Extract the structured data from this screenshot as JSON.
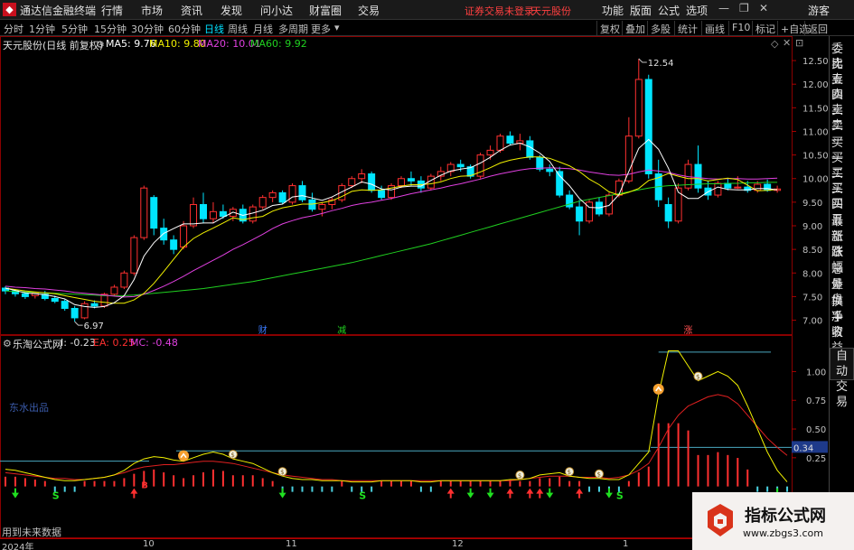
{
  "menubar": {
    "app_title": "通达信金融终端",
    "items": [
      "行情",
      "市场",
      "资讯",
      "发现",
      "问小达",
      "财富圈",
      "交易"
    ],
    "warning": "证券交易未登录",
    "stock_name": "天元股份",
    "right_items": [
      "功能",
      "版面",
      "公式",
      "选项"
    ],
    "guest_label": "游客"
  },
  "toolbar": {
    "periods": [
      "分时",
      "1分钟",
      "5分钟",
      "15分钟",
      "30分钟",
      "60分钟",
      "日线",
      "周线",
      "月线",
      "多周期",
      "更多"
    ],
    "active_period": "日线",
    "right_buttons": [
      "复权",
      "叠加",
      "多股",
      "统计",
      "画线",
      "F10",
      "标记",
      "+自选",
      "返回"
    ]
  },
  "sidebar": {
    "items": [
      "委比",
      "卖五",
      "卖四",
      "卖三",
      "卖二",
      "卖一",
      "买一",
      "买二",
      "买三",
      "买四",
      "买五",
      "最新",
      "涨跌",
      "涨幅",
      "总量",
      "外盘",
      "换手",
      "净资",
      "收益"
    ],
    "auto_trade": [
      "自动",
      "交易"
    ]
  },
  "main": {
    "title": "天元股份(日线 前复权)",
    "ma5": "MA5: 9.76",
    "ma10": "MA10: 9.80",
    "ma20": "MA20: 10.01",
    "ma60": "MA60: 9.92",
    "high_label": "12.54",
    "low_label": "6.97",
    "event_labels": [
      "财",
      "减",
      "涨"
    ],
    "y_ticks": [
      "12.50",
      "12.00",
      "11.50",
      "11.00",
      "10.50",
      "10.00",
      "9.50",
      "9.00",
      "8.50",
      "8.00",
      "7.50",
      "7.00"
    ],
    "colors": {
      "up": "#ff3030",
      "down": "#00e5ff",
      "ma5": "#ffffff",
      "ma10": "#f0f000",
      "ma20": "#e040e0",
      "ma60": "#20d020"
    }
  },
  "indicator": {
    "title": "乐淘公式网",
    "i_value": "I: -0.23",
    "ea_value": "EA: 0.25",
    "mc_value": "MC: -0.48",
    "caption": "东水出品",
    "y_ticks": [
      "1.00",
      "0.75",
      "0.50",
      "0.25"
    ],
    "current_value": "0.34",
    "footer_note": "用到未来数据"
  },
  "xaxis": {
    "labels": [
      "2024年",
      "10",
      "11",
      "12",
      "1"
    ]
  },
  "watermark": {
    "title": "指标公式网",
    "url": "www.zbgs3.com"
  },
  "chart_data": [
    {
      "type": "candlestick",
      "title": "天元股份(日线 前复权)",
      "ylim": [
        6.8,
        12.75
      ],
      "candles": [
        {
          "o": 7.68,
          "h": 7.72,
          "l": 7.55,
          "c": 7.62
        },
        {
          "o": 7.62,
          "h": 7.66,
          "l": 7.5,
          "c": 7.56
        },
        {
          "o": 7.56,
          "h": 7.6,
          "l": 7.45,
          "c": 7.5
        },
        {
          "o": 7.52,
          "h": 7.6,
          "l": 7.46,
          "c": 7.58
        },
        {
          "o": 7.55,
          "h": 7.62,
          "l": 7.42,
          "c": 7.46
        },
        {
          "o": 7.46,
          "h": 7.52,
          "l": 7.36,
          "c": 7.4
        },
        {
          "o": 7.4,
          "h": 7.44,
          "l": 7.2,
          "c": 7.25
        },
        {
          "o": 7.25,
          "h": 7.3,
          "l": 6.97,
          "c": 7.05
        },
        {
          "o": 7.05,
          "h": 7.4,
          "l": 7.02,
          "c": 7.35
        },
        {
          "o": 7.35,
          "h": 7.42,
          "l": 7.25,
          "c": 7.3
        },
        {
          "o": 7.3,
          "h": 7.58,
          "l": 7.26,
          "c": 7.55
        },
        {
          "o": 7.55,
          "h": 7.75,
          "l": 7.5,
          "c": 7.7
        },
        {
          "o": 7.7,
          "h": 8.05,
          "l": 7.66,
          "c": 8.0
        },
        {
          "o": 8.0,
          "h": 8.8,
          "l": 7.95,
          "c": 8.75
        },
        {
          "o": 8.75,
          "h": 9.85,
          "l": 8.7,
          "c": 9.8
        },
        {
          "o": 9.6,
          "h": 9.65,
          "l": 8.8,
          "c": 8.95
        },
        {
          "o": 8.95,
          "h": 9.15,
          "l": 8.6,
          "c": 8.7
        },
        {
          "o": 8.7,
          "h": 8.8,
          "l": 8.4,
          "c": 8.5
        },
        {
          "o": 8.55,
          "h": 9.1,
          "l": 8.5,
          "c": 9.0
        },
        {
          "o": 9.0,
          "h": 9.6,
          "l": 8.95,
          "c": 9.45
        },
        {
          "o": 9.45,
          "h": 9.7,
          "l": 9.05,
          "c": 9.15
        },
        {
          "o": 9.15,
          "h": 9.5,
          "l": 9.05,
          "c": 9.3
        },
        {
          "o": 9.3,
          "h": 9.45,
          "l": 9.15,
          "c": 9.2
        },
        {
          "o": 9.2,
          "h": 9.4,
          "l": 9.1,
          "c": 9.35
        },
        {
          "o": 9.35,
          "h": 9.45,
          "l": 9.05,
          "c": 9.1
        },
        {
          "o": 9.1,
          "h": 9.45,
          "l": 9.05,
          "c": 9.4
        },
        {
          "o": 9.4,
          "h": 9.65,
          "l": 9.35,
          "c": 9.6
        },
        {
          "o": 9.6,
          "h": 9.75,
          "l": 9.5,
          "c": 9.7
        },
        {
          "o": 9.7,
          "h": 9.75,
          "l": 9.45,
          "c": 9.5
        },
        {
          "o": 9.5,
          "h": 9.9,
          "l": 9.45,
          "c": 9.85
        },
        {
          "o": 9.85,
          "h": 9.95,
          "l": 9.5,
          "c": 9.55
        },
        {
          "o": 9.55,
          "h": 9.7,
          "l": 9.3,
          "c": 9.35
        },
        {
          "o": 9.35,
          "h": 9.5,
          "l": 9.2,
          "c": 9.45
        },
        {
          "o": 9.45,
          "h": 9.6,
          "l": 9.35,
          "c": 9.55
        },
        {
          "o": 9.55,
          "h": 9.9,
          "l": 9.5,
          "c": 9.85
        },
        {
          "o": 9.85,
          "h": 10.05,
          "l": 9.8,
          "c": 10.0
        },
        {
          "o": 10.0,
          "h": 10.2,
          "l": 9.9,
          "c": 10.1
        },
        {
          "o": 10.1,
          "h": 10.15,
          "l": 9.7,
          "c": 9.75
        },
        {
          "o": 9.75,
          "h": 9.85,
          "l": 9.55,
          "c": 9.6
        },
        {
          "o": 9.6,
          "h": 9.9,
          "l": 9.55,
          "c": 9.85
        },
        {
          "o": 9.85,
          "h": 10.05,
          "l": 9.8,
          "c": 10.0
        },
        {
          "o": 10.0,
          "h": 10.15,
          "l": 9.85,
          "c": 9.95
        },
        {
          "o": 9.95,
          "h": 10.05,
          "l": 9.7,
          "c": 9.8
        },
        {
          "o": 9.8,
          "h": 10.1,
          "l": 9.75,
          "c": 10.05
        },
        {
          "o": 10.05,
          "h": 10.25,
          "l": 9.95,
          "c": 10.15
        },
        {
          "o": 10.15,
          "h": 10.35,
          "l": 10.05,
          "c": 10.3
        },
        {
          "o": 10.3,
          "h": 10.4,
          "l": 10.15,
          "c": 10.25
        },
        {
          "o": 10.25,
          "h": 10.3,
          "l": 10.0,
          "c": 10.05
        },
        {
          "o": 10.05,
          "h": 10.55,
          "l": 10.0,
          "c": 10.5
        },
        {
          "o": 10.5,
          "h": 10.7,
          "l": 10.4,
          "c": 10.6
        },
        {
          "o": 10.6,
          "h": 10.95,
          "l": 10.55,
          "c": 10.9
        },
        {
          "o": 10.9,
          "h": 11.0,
          "l": 10.7,
          "c": 10.75
        },
        {
          "o": 10.75,
          "h": 10.95,
          "l": 10.6,
          "c": 10.8
        },
        {
          "o": 10.8,
          "h": 10.9,
          "l": 10.4,
          "c": 10.45
        },
        {
          "o": 10.45,
          "h": 10.5,
          "l": 10.15,
          "c": 10.2
        },
        {
          "o": 10.2,
          "h": 10.3,
          "l": 10.05,
          "c": 10.15
        },
        {
          "o": 10.15,
          "h": 10.25,
          "l": 9.6,
          "c": 9.65
        },
        {
          "o": 9.65,
          "h": 9.75,
          "l": 9.35,
          "c": 9.4
        },
        {
          "o": 9.4,
          "h": 9.55,
          "l": 8.8,
          "c": 9.1
        },
        {
          "o": 9.1,
          "h": 9.55,
          "l": 9.05,
          "c": 9.5
        },
        {
          "o": 9.5,
          "h": 9.6,
          "l": 9.2,
          "c": 9.25
        },
        {
          "o": 9.25,
          "h": 9.7,
          "l": 9.2,
          "c": 9.65
        },
        {
          "o": 9.65,
          "h": 10.0,
          "l": 9.6,
          "c": 9.95
        },
        {
          "o": 9.95,
          "h": 11.3,
          "l": 9.9,
          "c": 10.9
        },
        {
          "o": 10.9,
          "h": 12.54,
          "l": 10.85,
          "c": 12.1
        },
        {
          "o": 12.1,
          "h": 12.2,
          "l": 10.0,
          "c": 10.1
        },
        {
          "o": 10.1,
          "h": 10.4,
          "l": 9.4,
          "c": 9.55
        },
        {
          "o": 9.45,
          "h": 9.6,
          "l": 8.95,
          "c": 9.1
        },
        {
          "o": 9.1,
          "h": 9.9,
          "l": 9.05,
          "c": 9.8
        },
        {
          "o": 9.8,
          "h": 10.4,
          "l": 9.75,
          "c": 10.3
        },
        {
          "o": 10.3,
          "h": 10.7,
          "l": 9.7,
          "c": 9.8
        },
        {
          "o": 9.8,
          "h": 9.95,
          "l": 9.55,
          "c": 9.65
        },
        {
          "o": 9.65,
          "h": 9.95,
          "l": 9.6,
          "c": 9.9
        },
        {
          "o": 9.9,
          "h": 10.0,
          "l": 9.75,
          "c": 9.8
        },
        {
          "o": 9.8,
          "h": 10.05,
          "l": 9.78,
          "c": 9.82
        },
        {
          "o": 9.82,
          "h": 9.95,
          "l": 9.7,
          "c": 9.75
        },
        {
          "o": 9.75,
          "h": 9.95,
          "l": 9.7,
          "c": 9.88
        },
        {
          "o": 9.88,
          "h": 9.98,
          "l": 9.72,
          "c": 9.75
        },
        {
          "o": 9.75,
          "h": 9.85,
          "l": 9.7,
          "c": 9.78
        }
      ],
      "ma5": [
        7.68,
        7.63,
        7.58,
        7.56,
        7.54,
        7.5,
        7.45,
        7.33,
        7.29,
        7.27,
        7.29,
        7.37,
        7.52,
        7.86,
        8.36,
        8.64,
        8.84,
        8.94,
        9.04,
        9.04,
        9.06,
        9.06,
        9.18,
        9.29,
        9.22,
        9.27,
        9.33,
        9.43,
        9.46,
        9.61,
        9.64,
        9.59,
        9.54,
        9.61,
        9.72,
        9.82,
        9.93,
        9.88,
        9.78,
        9.76,
        9.82,
        9.84,
        9.84,
        9.96,
        10.07,
        10.16,
        10.2,
        10.23,
        10.33,
        10.45,
        10.6,
        10.71,
        10.75,
        10.67,
        10.54,
        10.36,
        10.06,
        9.85,
        9.58,
        9.39,
        9.38,
        9.43,
        9.66,
        10.15,
        10.64,
        10.83,
        10.62,
        10.22,
        9.71,
        9.58,
        9.58,
        9.72,
        9.82,
        9.77,
        9.76,
        9.76,
        9.79,
        9.79,
        9.76
      ],
      "ma10": [
        7.68,
        7.65,
        7.62,
        7.6,
        7.58,
        7.56,
        7.52,
        7.48,
        7.44,
        7.4,
        7.38,
        7.36,
        7.36,
        7.43,
        7.57,
        7.78,
        8.03,
        8.29,
        8.55,
        8.73,
        8.85,
        8.95,
        9.06,
        9.17,
        9.13,
        9.17,
        9.2,
        9.31,
        9.38,
        9.42,
        9.46,
        9.46,
        9.49,
        9.53,
        9.62,
        9.73,
        9.76,
        9.75,
        9.76,
        9.8,
        9.84,
        9.87,
        9.87,
        9.89,
        9.93,
        10.0,
        10.05,
        10.06,
        10.14,
        10.23,
        10.33,
        10.39,
        10.43,
        10.46,
        10.46,
        10.43,
        10.35,
        10.27,
        10.15,
        9.99,
        9.87,
        9.72,
        9.65,
        9.71,
        9.79,
        9.96,
        10.02,
        10.11,
        10.05,
        10.0,
        10.0,
        9.95,
        9.98,
        10.01,
        9.98,
        9.86,
        9.74,
        9.75,
        9.77
      ],
      "ma20": [
        7.72,
        7.7,
        7.69,
        7.67,
        7.66,
        7.64,
        7.62,
        7.59,
        7.57,
        7.55,
        7.53,
        7.51,
        7.49,
        7.5,
        7.55,
        7.63,
        7.72,
        7.82,
        7.93,
        8.05,
        8.16,
        8.27,
        8.38,
        8.5,
        8.6,
        8.71,
        8.82,
        8.94,
        9.04,
        9.11,
        9.17,
        9.21,
        9.26,
        9.32,
        9.37,
        9.43,
        9.47,
        9.5,
        9.54,
        9.58,
        9.63,
        9.68,
        9.72,
        9.76,
        9.8,
        9.85,
        9.89,
        9.94,
        9.99,
        10.05,
        10.1,
        10.14,
        10.18,
        10.21,
        10.22,
        10.23,
        10.22,
        10.21,
        10.18,
        10.14,
        10.11,
        10.08,
        10.07,
        10.09,
        10.14,
        10.18,
        10.16,
        10.13,
        10.08,
        10.04,
        10.02,
        10.0,
        9.99,
        10.0,
        10.0,
        9.99,
        9.99,
        10.0,
        10.01
      ],
      "ma60": [
        7.62,
        7.61,
        7.6,
        7.59,
        7.58,
        7.57,
        7.56,
        7.55,
        7.54,
        7.53,
        7.52,
        7.52,
        7.52,
        7.53,
        7.55,
        7.57,
        7.59,
        7.61,
        7.63,
        7.65,
        7.67,
        7.7,
        7.73,
        7.76,
        7.79,
        7.82,
        7.86,
        7.9,
        7.94,
        7.98,
        8.02,
        8.06,
        8.1,
        8.14,
        8.18,
        8.22,
        8.27,
        8.32,
        8.37,
        8.42,
        8.47,
        8.52,
        8.57,
        8.62,
        8.68,
        8.74,
        8.8,
        8.86,
        8.92,
        8.98,
        9.04,
        9.1,
        9.16,
        9.22,
        9.28,
        9.34,
        9.4,
        9.46,
        9.52,
        9.56,
        9.6,
        9.64,
        9.68,
        9.72,
        9.76,
        9.8,
        9.83,
        9.85,
        9.86,
        9.87,
        9.88,
        9.89,
        9.89,
        9.9,
        9.9,
        9.91,
        9.91,
        9.92,
        9.92
      ]
    },
    {
      "type": "line",
      "title": "乐淘公式网",
      "ylim": [
        -0.05,
        1.2
      ],
      "series": [
        {
          "name": "I",
          "values": [
            0.15,
            0.14,
            0.12,
            0.1,
            0.08,
            0.06,
            0.05,
            0.05,
            0.06,
            0.07,
            0.08,
            0.1,
            0.14,
            0.2,
            0.24,
            0.26,
            0.25,
            0.23,
            0.22,
            0.25,
            0.28,
            0.3,
            0.28,
            0.24,
            0.22,
            0.2,
            0.16,
            0.12,
            0.09,
            0.07,
            0.06,
            0.06,
            0.05,
            0.05,
            0.05,
            0.04,
            0.04,
            0.04,
            0.05,
            0.05,
            0.05,
            0.05,
            0.04,
            0.04,
            0.05,
            0.05,
            0.05,
            0.05,
            0.05,
            0.05,
            0.05,
            0.06,
            0.06,
            0.07,
            0.1,
            0.11,
            0.12,
            0.09,
            0.08,
            0.07,
            0.07,
            0.06,
            0.06,
            0.1,
            0.2,
            0.3,
            0.8,
            1.18,
            1.18,
            1.05,
            0.92,
            0.96,
            1.0,
            0.96,
            0.88,
            0.7,
            0.5,
            0.3,
            0.14,
            0.04
          ]
        },
        {
          "name": "EA",
          "values": [
            0.12,
            0.11,
            0.1,
            0.09,
            0.08,
            0.07,
            0.07,
            0.06,
            0.06,
            0.07,
            0.08,
            0.1,
            0.12,
            0.15,
            0.17,
            0.18,
            0.19,
            0.19,
            0.2,
            0.21,
            0.22,
            0.22,
            0.21,
            0.2,
            0.18,
            0.16,
            0.14,
            0.12,
            0.1,
            0.09,
            0.08,
            0.07,
            0.06,
            0.06,
            0.05,
            0.05,
            0.05,
            0.05,
            0.05,
            0.05,
            0.05,
            0.05,
            0.05,
            0.05,
            0.05,
            0.05,
            0.05,
            0.05,
            0.05,
            0.05,
            0.05,
            0.05,
            0.06,
            0.07,
            0.08,
            0.09,
            0.09,
            0.09,
            0.08,
            0.08,
            0.08,
            0.07,
            0.08,
            0.1,
            0.14,
            0.2,
            0.34,
            0.5,
            0.62,
            0.7,
            0.74,
            0.78,
            0.8,
            0.78,
            0.72,
            0.62,
            0.52,
            0.42,
            0.34,
            0.27
          ]
        }
      ],
      "reference_lines": [
        0.34,
        1.17
      ],
      "signals": [
        {
          "kind": "up",
          "i": 13
        },
        {
          "kind": "up",
          "i": 45
        },
        {
          "kind": "up",
          "i": 51
        },
        {
          "kind": "up",
          "i": 53
        },
        {
          "kind": "up",
          "i": 54
        },
        {
          "kind": "up",
          "i": 58
        },
        {
          "kind": "down",
          "i": 1
        },
        {
          "kind": "down",
          "i": 28
        },
        {
          "kind": "down",
          "i": 47
        },
        {
          "kind": "down",
          "i": 49
        },
        {
          "kind": "down",
          "i": 55
        },
        {
          "kind": "down",
          "i": 61
        },
        {
          "kind": "down",
          "i": 78
        },
        {
          "kind": "coin",
          "i": 23
        },
        {
          "kind": "coin",
          "i": 28
        },
        {
          "kind": "coin",
          "i": 52
        },
        {
          "kind": "coin",
          "i": 57
        },
        {
          "kind": "coin",
          "i": 60
        },
        {
          "kind": "coin",
          "i": 70
        },
        {
          "kind": "warn",
          "i": 18
        },
        {
          "kind": "warn",
          "i": 66
        },
        {
          "kind": "S",
          "i": 5
        },
        {
          "kind": "S",
          "i": 36
        },
        {
          "kind": "S",
          "i": 62
        }
      ]
    }
  ]
}
